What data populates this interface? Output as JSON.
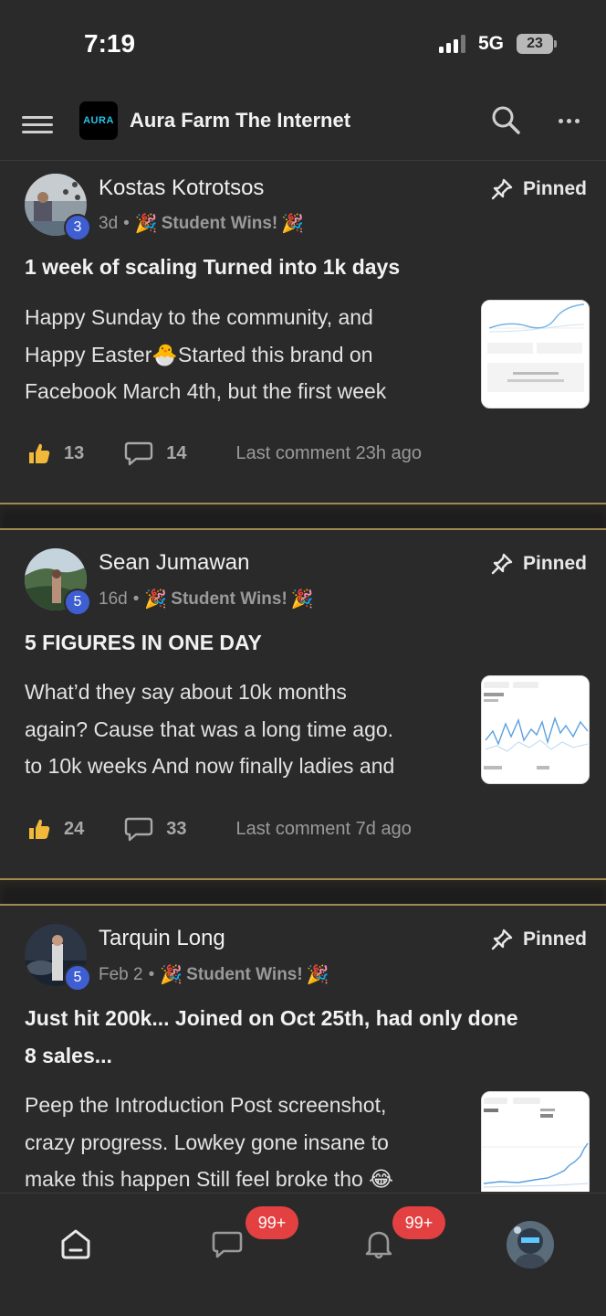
{
  "status_bar": {
    "time": "7:19",
    "network": "5G",
    "battery": "23"
  },
  "header": {
    "logo_text": "AURA",
    "title": "Aura Farm The Internet"
  },
  "posts": [
    {
      "author": "Kostas Kotrotsos",
      "level": "3",
      "age": "3d",
      "category": "Student Wins!",
      "pinned_label": "Pinned",
      "title": "1 week of scaling Turned into 1k days",
      "body": [
        "Happy Sunday to the community, and",
        "Happy Easter🐣Started this brand on",
        "Facebook March 4th, but the first week"
      ],
      "likes": "13",
      "comments": "14",
      "last_comment": "Last comment 23h ago"
    },
    {
      "author": "Sean Jumawan",
      "level": "5",
      "age": "16d",
      "category": "Student Wins!",
      "pinned_label": "Pinned",
      "title": "5 FIGURES IN ONE DAY",
      "body": [
        "What’d they say about 10k months",
        "again? Cause that was a long time ago.",
        "to 10k weeks And now finally ladies and"
      ],
      "likes": "24",
      "comments": "33",
      "last_comment": "Last comment 7d ago"
    },
    {
      "author": "Tarquin Long",
      "level": "5",
      "age": "Feb 2",
      "category": "Student Wins!",
      "pinned_label": "Pinned",
      "title_lines": [
        "Just hit 200k... Joined on Oct 25th, had only done",
        "8 sales..."
      ],
      "body": [
        "Peep the Introduction Post screenshot,",
        "crazy progress. Lowkey gone insane to",
        "make this happen Still feel broke tho 😂"
      ]
    }
  ],
  "bottom_nav": {
    "messages_badge": "99+",
    "notifications_badge": "99+"
  },
  "colors": {
    "background": "#2a2a2b",
    "accent_gold": "#a08a52",
    "badge_red": "#e34141",
    "level_blue": "#3f5ed1"
  }
}
